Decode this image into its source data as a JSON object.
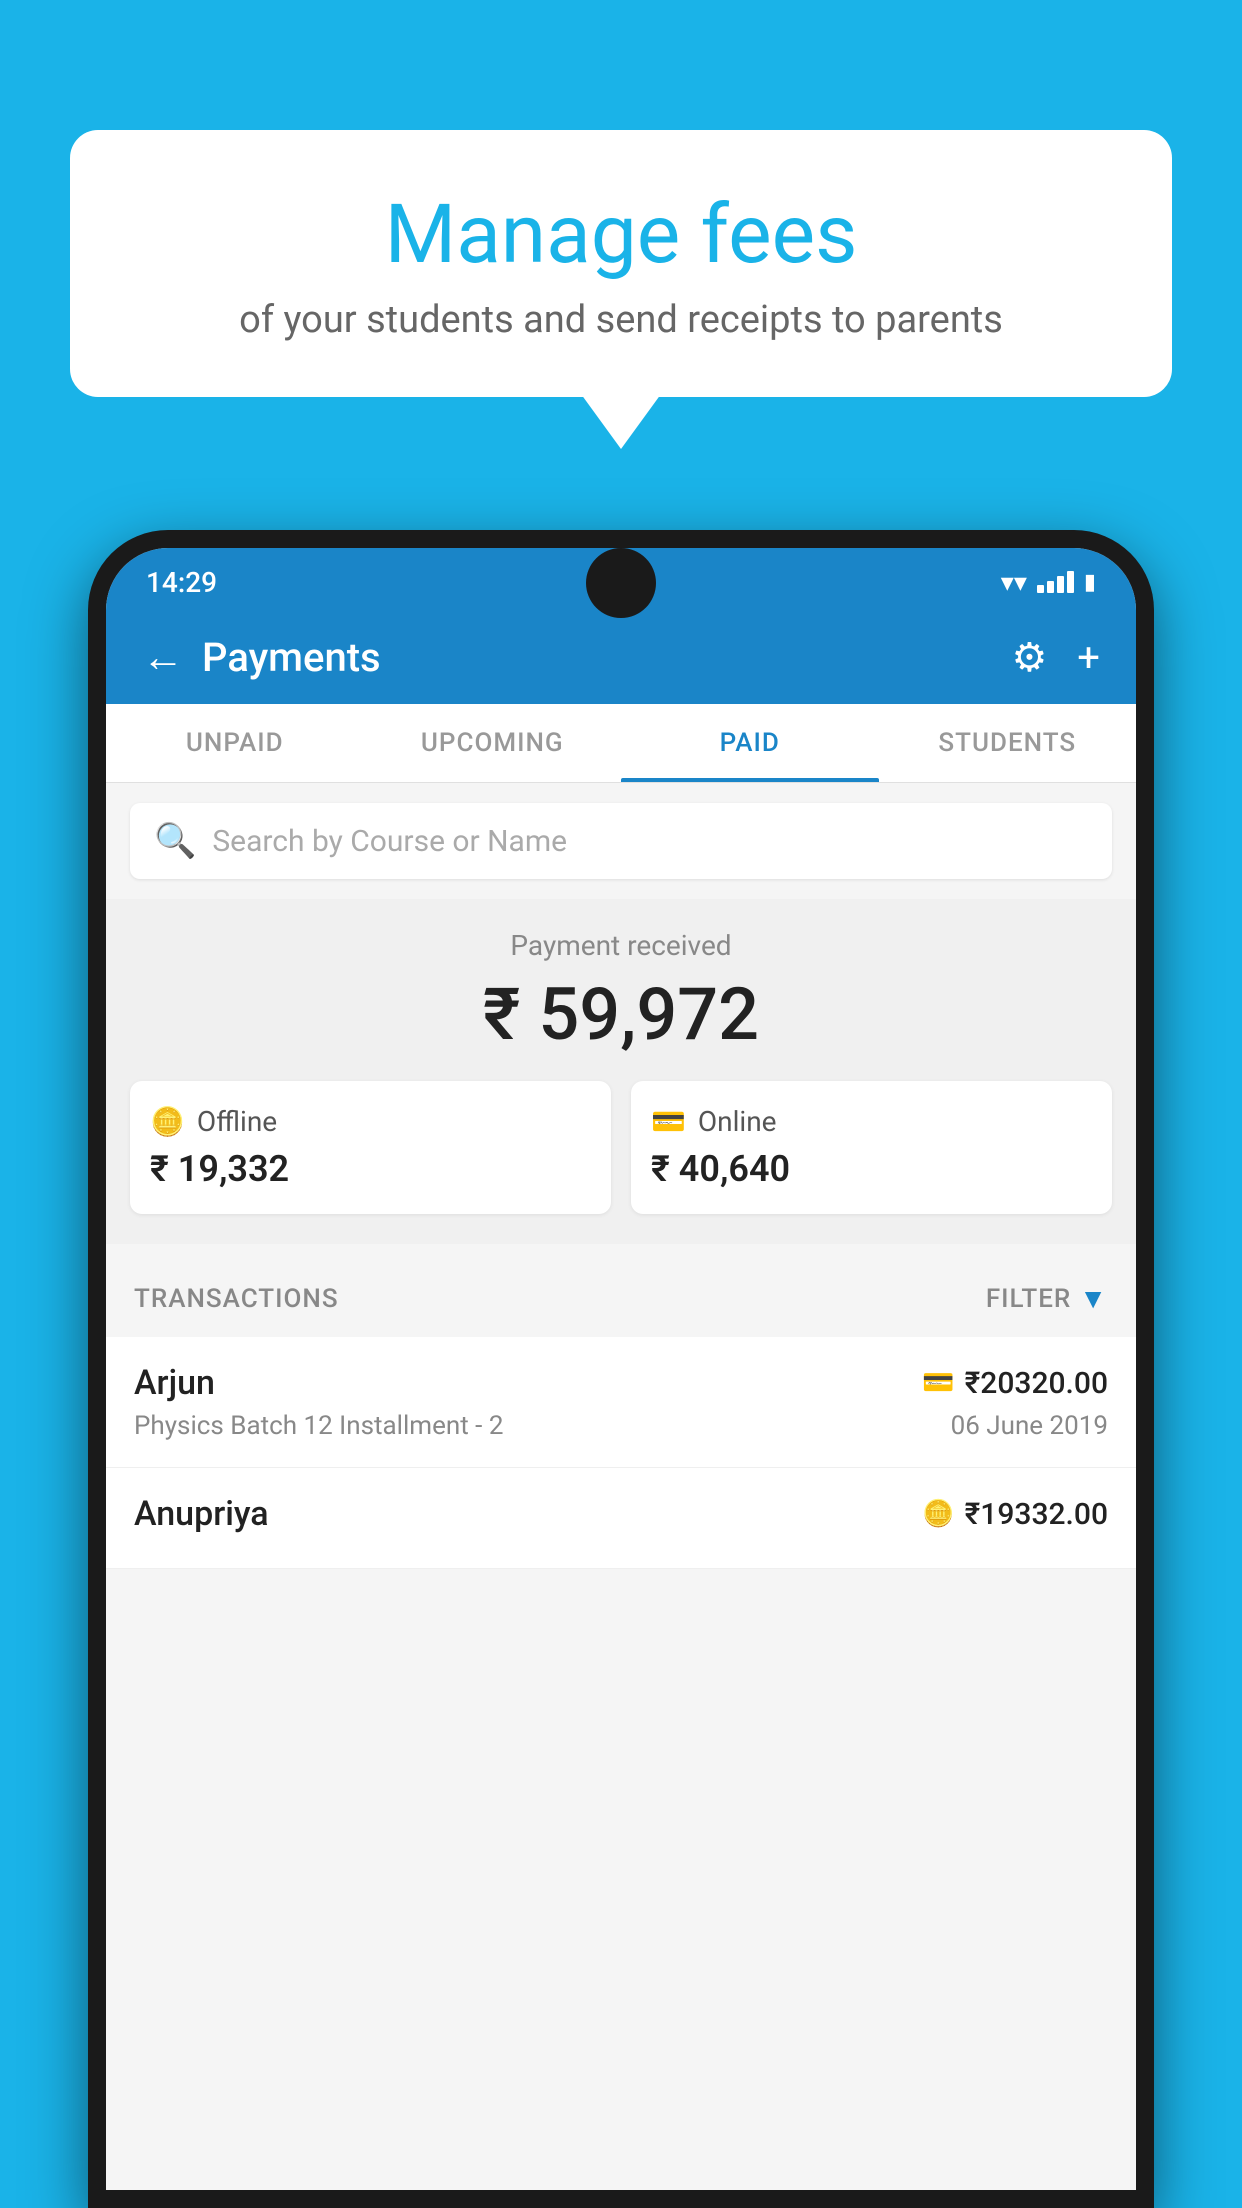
{
  "background_color": "#1ab3e8",
  "speech_bubble": {
    "title": "Manage fees",
    "subtitle": "of your students and send receipts to parents"
  },
  "status_bar": {
    "time": "14:29"
  },
  "toolbar": {
    "title": "Payments",
    "back_label": "←",
    "settings_label": "⚙",
    "add_label": "+"
  },
  "tabs": [
    {
      "label": "UNPAID",
      "active": false
    },
    {
      "label": "UPCOMING",
      "active": false
    },
    {
      "label": "PAID",
      "active": true
    },
    {
      "label": "STUDENTS",
      "active": false
    }
  ],
  "search": {
    "placeholder": "Search by Course or Name"
  },
  "payment_received": {
    "label": "Payment received",
    "total_amount": "₹ 59,972",
    "offline": {
      "label": "Offline",
      "amount": "₹ 19,332"
    },
    "online": {
      "label": "Online",
      "amount": "₹ 40,640"
    }
  },
  "transactions": {
    "header_label": "TRANSACTIONS",
    "filter_label": "FILTER",
    "items": [
      {
        "name": "Arjun",
        "amount": "₹20320.00",
        "course": "Physics Batch 12 Installment - 2",
        "date": "06 June 2019",
        "payment_type": "card"
      },
      {
        "name": "Anupriya",
        "amount": "₹19332.00",
        "course": "",
        "date": "",
        "payment_type": "offline"
      }
    ]
  }
}
